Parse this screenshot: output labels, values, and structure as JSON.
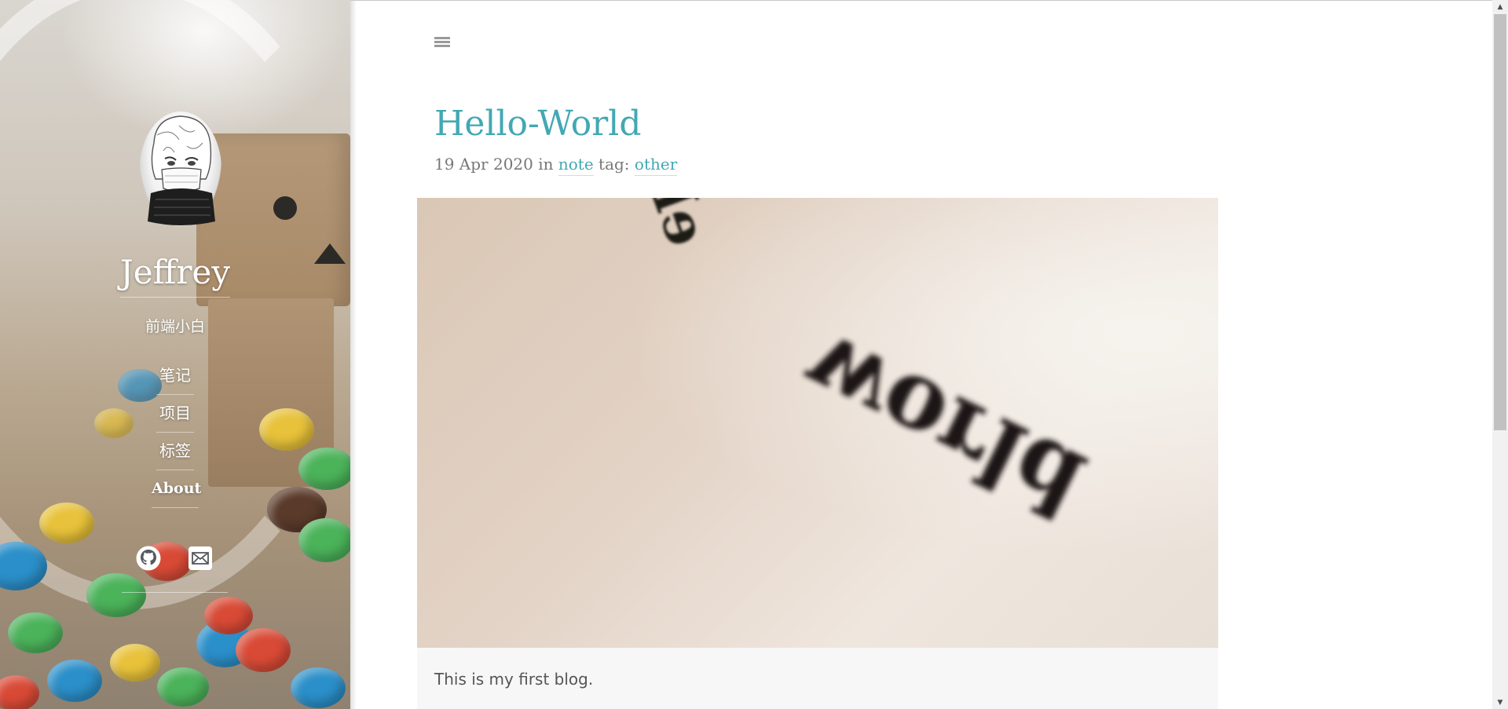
{
  "sidebar": {
    "title": "Jeffrey",
    "description": "前端小白",
    "nav": [
      {
        "label": "笔记"
      },
      {
        "label": "项目"
      },
      {
        "label": "标签"
      },
      {
        "label": "About"
      }
    ],
    "social": [
      {
        "icon": "github-icon"
      },
      {
        "icon": "mail-icon"
      }
    ]
  },
  "main": {
    "menu_icon": "menu-icon",
    "post": {
      "title": "Hello-World",
      "date": "19 Apr 2020",
      "in_label": "in",
      "category": "note",
      "tag_label": "tag:",
      "tag": "other",
      "image_text": "Hello World",
      "excerpt": "This is my first blog."
    }
  },
  "colors": {
    "accent": "#42a8b3",
    "meta_text": "#777777",
    "excerpt_bg": "#f7f7f7"
  }
}
